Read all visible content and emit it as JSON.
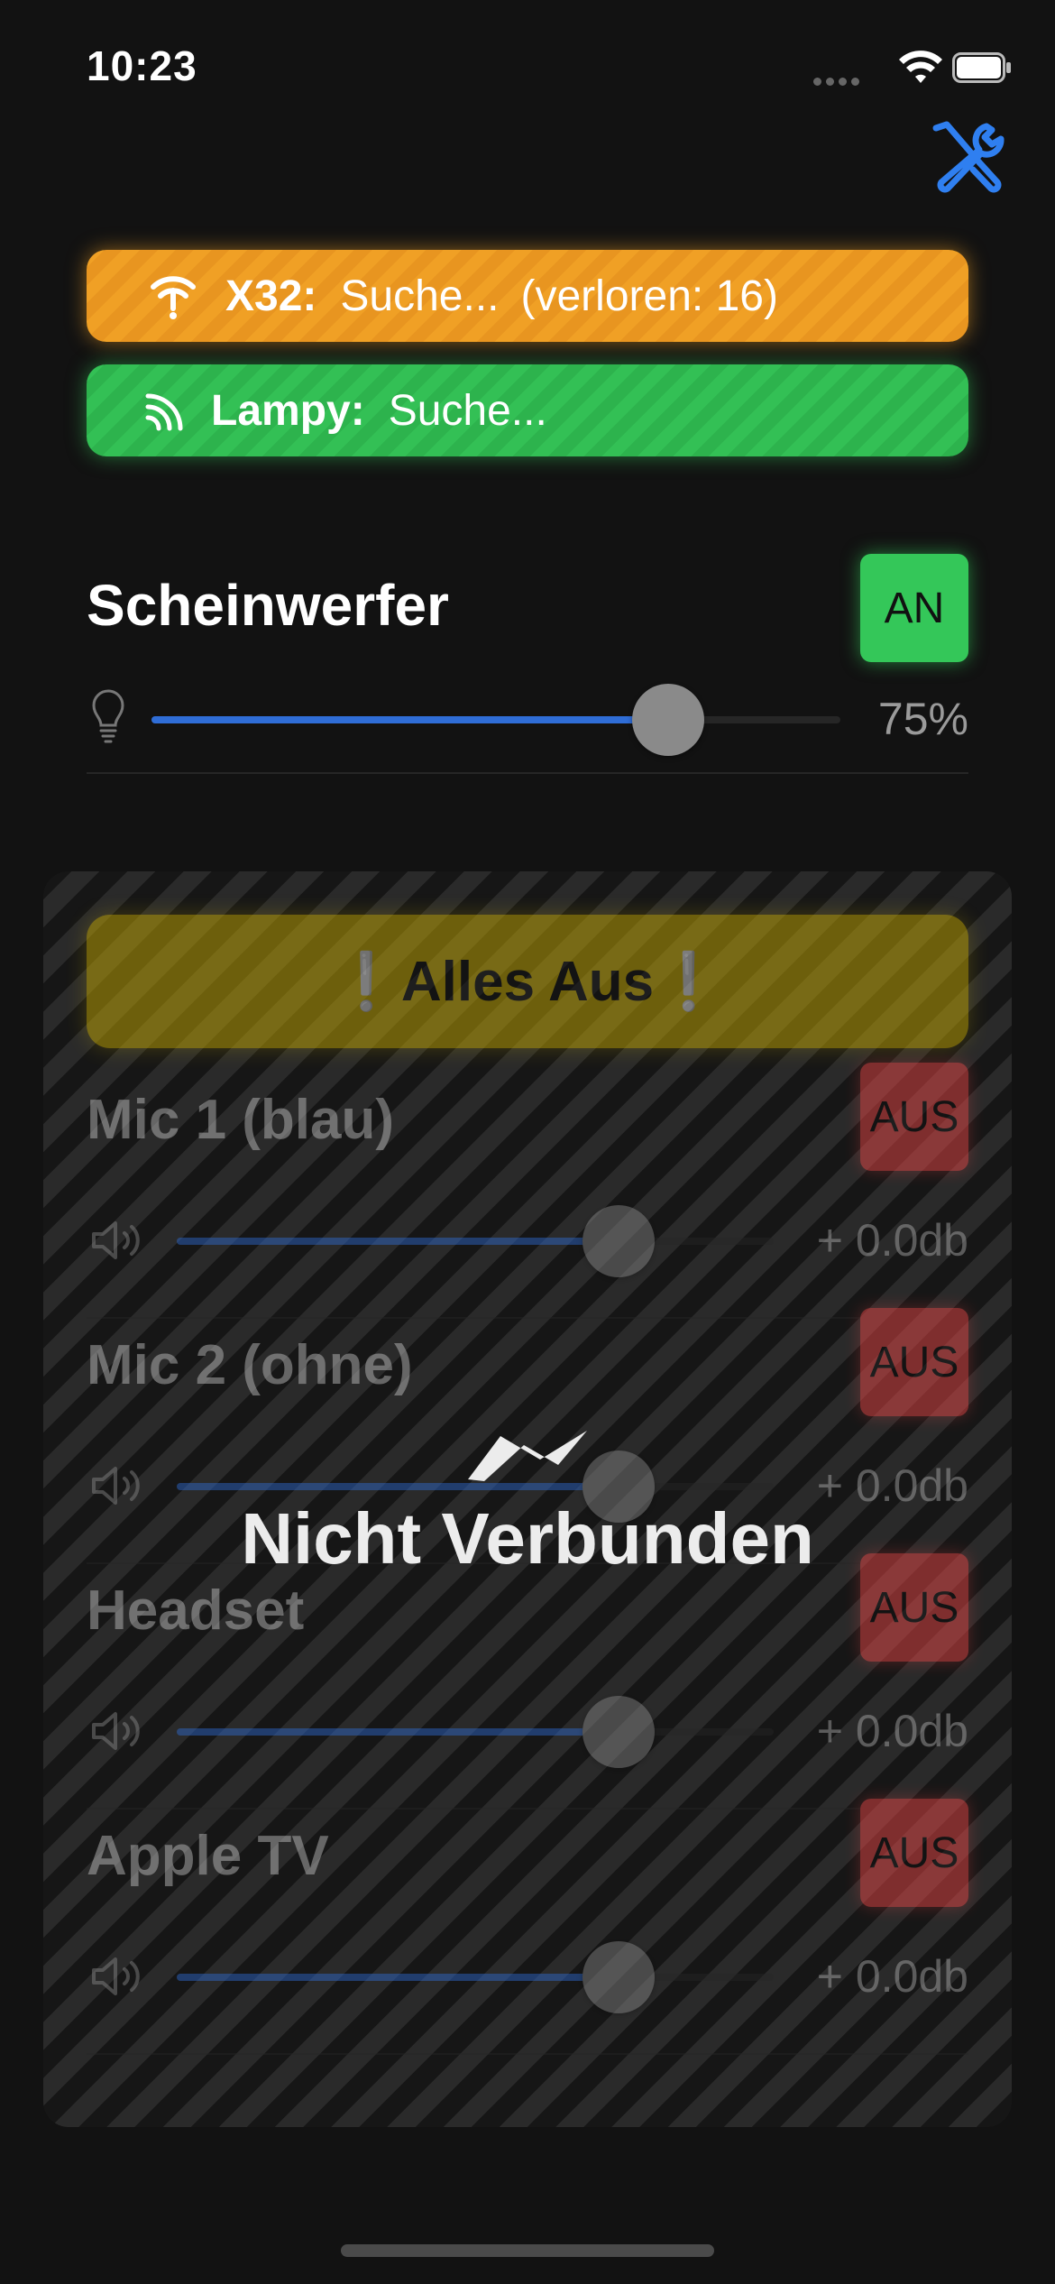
{
  "status_bar": {
    "time": "10:23"
  },
  "connections": [
    {
      "icon": "wifi-off-icon",
      "label": "X32:",
      "status": "Suche...",
      "extra": "(verloren: 16)",
      "color": "#f0a025"
    },
    {
      "icon": "rss-icon",
      "label": "Lampy:",
      "status": "Suche...",
      "extra": "",
      "color": "#33c055"
    }
  ],
  "spotlight": {
    "title": "Scheinwerfer",
    "toggle_label": "AN",
    "level_percent": 75,
    "value_label": "75%"
  },
  "mixer": {
    "all_off_label": "❕Alles Aus❕",
    "channels": [
      {
        "name": "Mic 1 (blau)",
        "toggle_label": "AUS",
        "gain_label": "+ 0.0db",
        "fader_fraction": 0.74
      },
      {
        "name": "Mic 2 (ohne)",
        "toggle_label": "AUS",
        "gain_label": "+ 0.0db",
        "fader_fraction": 0.74
      },
      {
        "name": "Headset",
        "toggle_label": "AUS",
        "gain_label": "+ 0.0db",
        "fader_fraction": 0.74
      },
      {
        "name": "Apple TV",
        "toggle_label": "AUS",
        "gain_label": "+ 0.0db",
        "fader_fraction": 0.74
      }
    ],
    "overlay_text": "Nicht Verbunden"
  },
  "colors": {
    "accent_blue": "#2f6dd6",
    "on_green": "#34c759",
    "off_red": "#ff4d4d",
    "warning_yellow": "#d8b800"
  }
}
